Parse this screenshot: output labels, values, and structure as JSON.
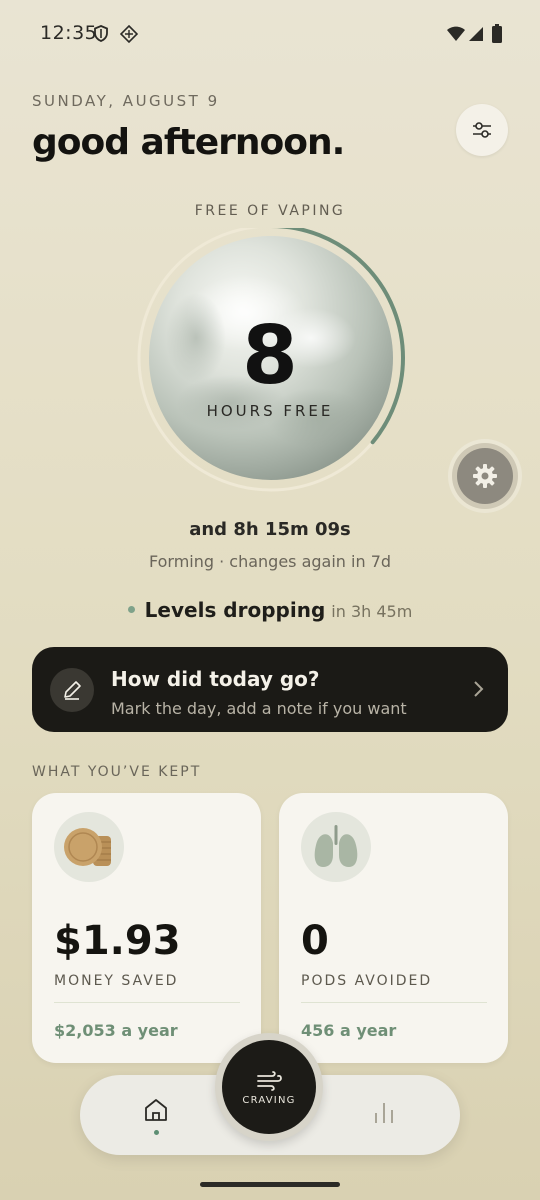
{
  "status_bar": {
    "time": "12:35"
  },
  "header": {
    "date": "SUNDAY, AUGUST 9",
    "greeting": "good afternoon."
  },
  "timer": {
    "label": "FREE OF VAPING",
    "big_number": "8",
    "unit": "HOURS FREE",
    "elapsed": "and 8h 15m 09s",
    "stage": "Forming",
    "stage_change": "changes again in 7d",
    "progress": 0.36
  },
  "health": {
    "label": "Levels dropping",
    "eta": "in 3h 45m"
  },
  "checkin": {
    "title": "How did today go?",
    "subtitle": "Mark the day, add a note if you want"
  },
  "kept": {
    "section_label": "WHAT YOU’VE KEPT",
    "cards": [
      {
        "value": "$1.93",
        "name": "MONEY SAVED",
        "yearly": "$2,053 a year",
        "icon": "coins-icon"
      },
      {
        "value": "0",
        "name": "PODS AVOIDED",
        "yearly": "456 a year",
        "icon": "lungs-icon"
      }
    ]
  },
  "nav": {
    "craving_label": "CRAVING",
    "items": [
      "home-icon",
      "chart-icon"
    ]
  },
  "colors": {
    "accent": "#7fa28a",
    "dark_card": "#1b1a16",
    "background": "#e6e0c9"
  }
}
